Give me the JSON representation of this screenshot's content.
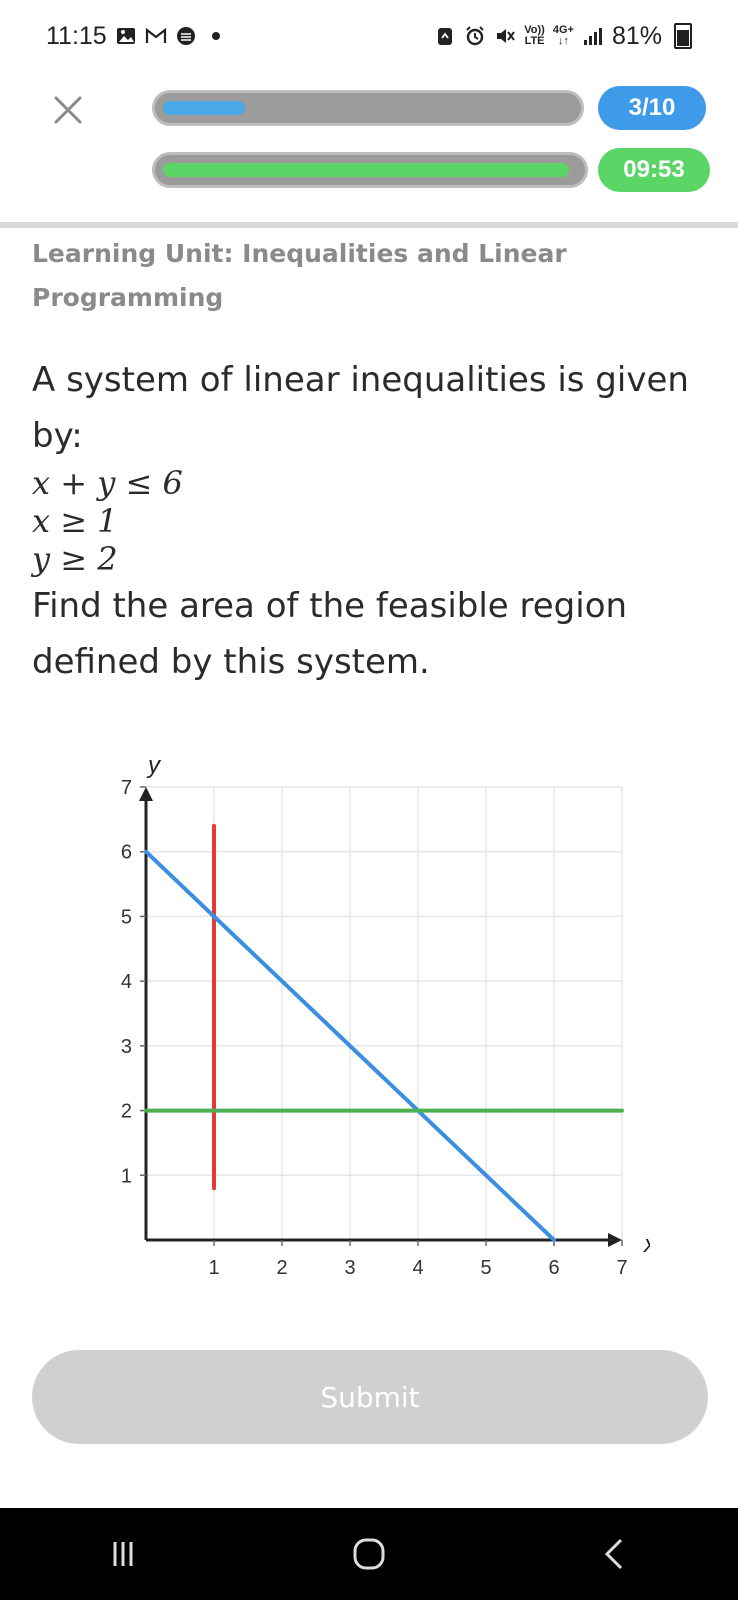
{
  "status_bar": {
    "time": "11:15",
    "network_top": "Vo))",
    "network_bottom": "LTE",
    "net_type": "4G+",
    "battery": "81%"
  },
  "header": {
    "question_counter": "3/10",
    "timer": "09:53",
    "question_progress": 0.2,
    "time_progress": 0.98,
    "colors": {
      "progress_blue": "#4aa8e8",
      "counter_blue": "#3d9be9",
      "timer_green": "#5ad566"
    }
  },
  "content": {
    "learning_unit": "Learning Unit: Inequalities and Linear Programming",
    "prompt_intro": "A system of linear inequalities is given by:",
    "inequality_1": "x + y ≤ 6",
    "inequality_2": "x ≥ 1",
    "inequality_3": "y ≥ 2",
    "prompt_question": "Find the area of the feasible region defined by this system."
  },
  "chart_data": {
    "type": "line",
    "xlabel": "x",
    "ylabel": "y",
    "xlim": [
      0,
      7
    ],
    "ylim": [
      0,
      7
    ],
    "x_ticks": [
      "1",
      "2",
      "3",
      "4",
      "5",
      "6",
      "7"
    ],
    "y_ticks": [
      "1",
      "2",
      "3",
      "4",
      "5",
      "6",
      "7"
    ],
    "grid": true,
    "series": [
      {
        "color": "#e53935",
        "points": [
          [
            1,
            6.4
          ],
          [
            1,
            0.8
          ]
        ]
      },
      {
        "color": "#3a8fe0",
        "points": [
          [
            0,
            6
          ],
          [
            6,
            0
          ]
        ]
      },
      {
        "color": "#4caf50",
        "points": [
          [
            0,
            2
          ],
          [
            7,
            2
          ]
        ]
      }
    ]
  },
  "footer": {
    "submit_label": "Submit"
  }
}
